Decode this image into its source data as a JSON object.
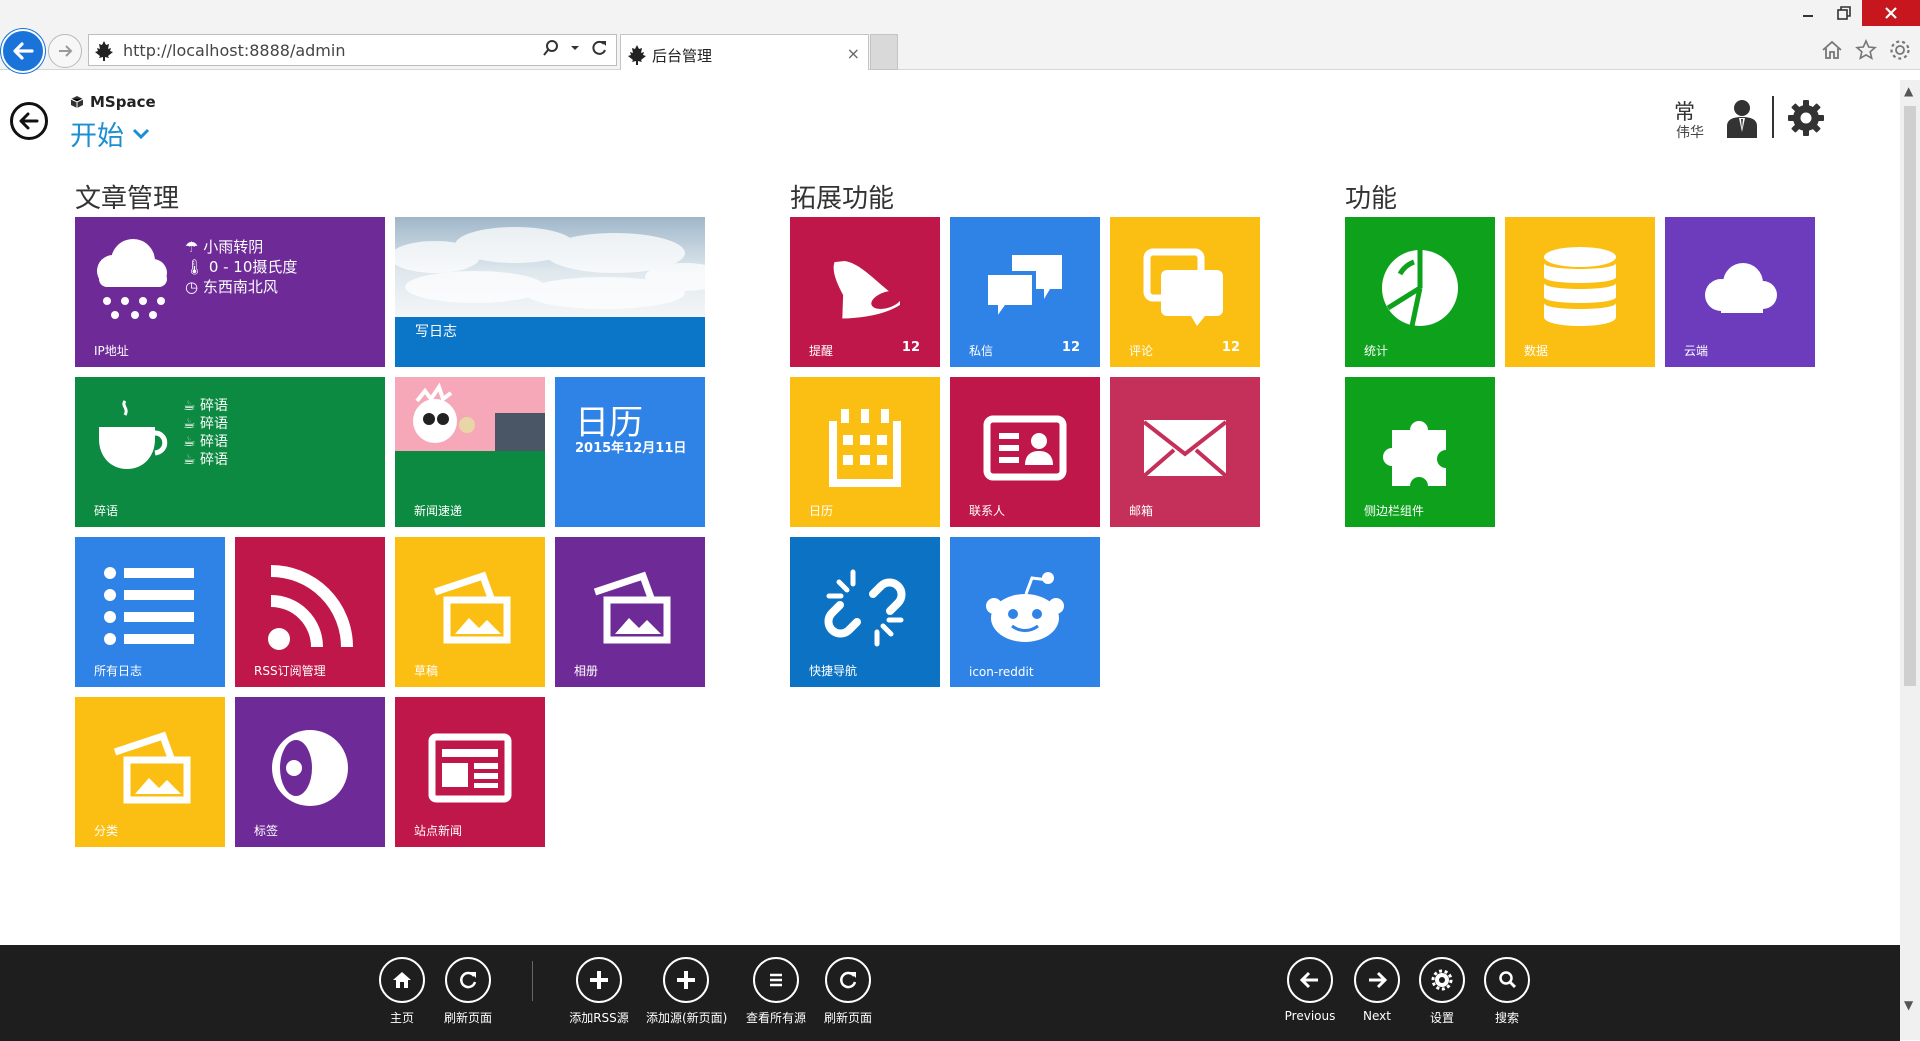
{
  "browser": {
    "url": "http://localhost:8888/admin",
    "tab_title": "后台管理",
    "tab_close": "×"
  },
  "header": {
    "app_name": "MSpace",
    "page_title": "开始",
    "user_last": "常",
    "user_first": "伟华"
  },
  "groups": {
    "articles": "文章管理",
    "extensions": "拓展功能",
    "features": "功能"
  },
  "tiles": {
    "ip": {
      "label": "IP地址",
      "weather": "小雨转阴",
      "temp": "0 - 10摄氏度",
      "wind": "东西南北风"
    },
    "blog": {
      "label": "写日志"
    },
    "gossip": {
      "label": "碎语",
      "lines": [
        "碎语",
        "碎语",
        "碎语",
        "碎语"
      ]
    },
    "news_fast": {
      "label": "新闻速递"
    },
    "calendar_big": {
      "title": "日历",
      "date": "2015年12月11日"
    },
    "all_logs": {
      "label": "所有日志"
    },
    "rss": {
      "label": "RSS订阅管理"
    },
    "drafts": {
      "label": "草稿"
    },
    "album": {
      "label": "相册"
    },
    "category": {
      "label": "分类"
    },
    "tags": {
      "label": "标签"
    },
    "site_news": {
      "label": "站点新闻"
    },
    "remind": {
      "label": "提醒",
      "count": "12"
    },
    "pm": {
      "label": "私信",
      "count": "12"
    },
    "comment": {
      "label": "评论",
      "count": "12"
    },
    "ext_calendar": {
      "label": "日历"
    },
    "contacts": {
      "label": "联系人"
    },
    "mail": {
      "label": "邮箱"
    },
    "quicknav": {
      "label": "快捷导航"
    },
    "reddit": {
      "label": "icon-reddit"
    },
    "stats": {
      "label": "统计"
    },
    "data": {
      "label": "数据"
    },
    "cloud": {
      "label": "云端"
    },
    "sidebar_widgets": {
      "label": "侧边栏组件"
    }
  },
  "appbar": {
    "home": "主页",
    "refresh1": "刷新页面",
    "add_rss": "添加RSS源",
    "add_rss_new": "添加源(新页面)",
    "view_all": "查看所有源",
    "refresh2": "刷新页面",
    "previous": "Previous",
    "next": "Next",
    "settings": "设置",
    "search": "搜索"
  },
  "colors": {
    "accent": "#1b8fd2",
    "purple": "#6e2b97",
    "crimson": "#c0174a",
    "blue": "#2f82e6",
    "yellow": "#fbbf14",
    "green": "#0c8a42",
    "bright_green": "#0ea21c",
    "violet": "#6c3cbd"
  }
}
